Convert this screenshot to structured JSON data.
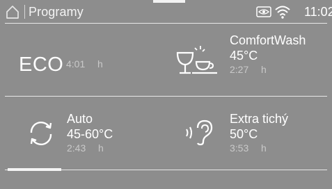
{
  "header": {
    "title": "Programy",
    "time": "11:02"
  },
  "programs": [
    {
      "id": "eco",
      "label": "ECO",
      "time": "4:01",
      "unit": "h",
      "icon": "eco-text"
    },
    {
      "id": "comfortwash",
      "name": "ComfortWash",
      "temperature": "45°C",
      "time": "2:27",
      "unit": "h",
      "icon": "glass-cup-icon"
    },
    {
      "id": "auto",
      "name": "Auto",
      "temperature": "45-60°C",
      "time": "2:43",
      "unit": "h",
      "icon": "refresh-icon"
    },
    {
      "id": "extra-quiet",
      "name": "Extra tichý",
      "temperature": "50°C",
      "time": "3:53",
      "unit": "h",
      "icon": "ear-sound-icon"
    }
  ],
  "colors": {
    "background": "#8d8d8d",
    "text": "#ffffff",
    "secondary_text": "#c9c9c9",
    "divider": "#e8e8e8"
  },
  "pager": {
    "pages": 2,
    "current": 1
  }
}
